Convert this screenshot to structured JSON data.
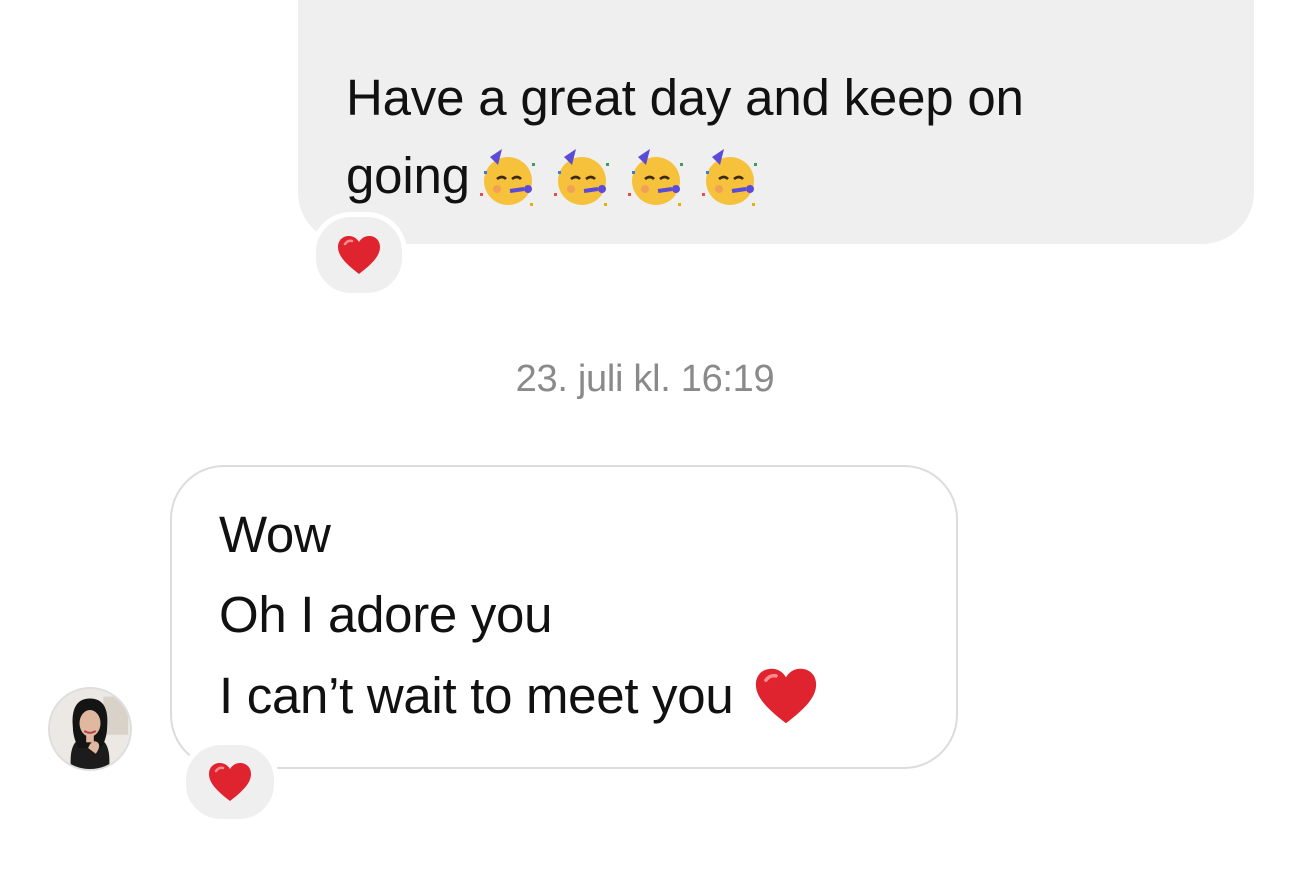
{
  "conversation": {
    "outgoing_message": {
      "line1": "Have a great day and keep on",
      "line2": "going",
      "emojis": [
        "partying-face",
        "partying-face",
        "partying-face",
        "partying-face"
      ],
      "reaction": "red-heart"
    },
    "timestamp": "23. juli kl. 16:19",
    "incoming_message": {
      "line1": "Wow",
      "line2": "Oh I adore you",
      "line3": "I can’t wait to meet you",
      "inline_emoji": "red-heart",
      "reaction": "red-heart"
    },
    "avatar": "contact-avatar"
  },
  "colors": {
    "outgoing_bubble": "#efefef",
    "incoming_border": "#dcdcdc",
    "timestamp_text": "#8a8a8a",
    "heart": "#e0242f"
  }
}
